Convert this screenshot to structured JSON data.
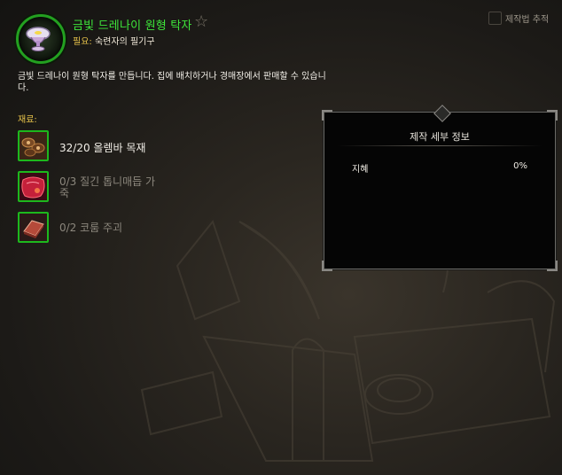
{
  "recipe": {
    "title": "금빛 드레나이 원형 탁자",
    "requires_label": "필요:",
    "requires_value": "숙련자의 필기구",
    "favorite_icon": "star-outline-icon",
    "icon": "golden-round-table-icon"
  },
  "track": {
    "label": "제작법 추적",
    "checked": false
  },
  "description": "금빛 드레나이 원형 탁자를 만듭니다. 집에 배치하거나 경매장에서 판매할 수 있습니다.",
  "reagents": {
    "title": "재료:",
    "items": [
      {
        "label": "32/20 올렘바 목재",
        "icon": "olemba-lumber-icon",
        "sufficient": true
      },
      {
        "label": "0/3 질긴 톱니매듭 가죽",
        "icon": "tough-sawtooth-leather-icon",
        "sufficient": false
      },
      {
        "label": "0/2 코룸 주괴",
        "icon": "korum-ingot-icon",
        "sufficient": false
      }
    ]
  },
  "details": {
    "title": "제작 세부 정보",
    "stat_name": "지혜",
    "stat_value": "0%"
  },
  "colors": {
    "title_green": "#3ee53a",
    "label_gold": "#e6c24a",
    "frame_green": "#1db81d"
  }
}
